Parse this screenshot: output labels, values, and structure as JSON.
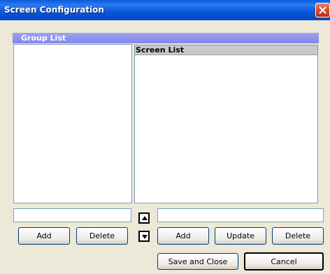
{
  "window": {
    "title": "Screen Configuration"
  },
  "group_list": {
    "title": "Group List",
    "input_value": "",
    "add_label": "Add",
    "delete_label": "Delete"
  },
  "screen_list": {
    "title": "Screen  List",
    "input_value": "",
    "add_label": "Add",
    "update_label": "Update",
    "delete_label": "Delete"
  },
  "footer": {
    "save_label": "Save and Close",
    "cancel_label": "Cancel"
  },
  "icons": {
    "close": "close-icon",
    "move_up": "arrow-up-icon",
    "move_down": "arrow-down-icon"
  }
}
